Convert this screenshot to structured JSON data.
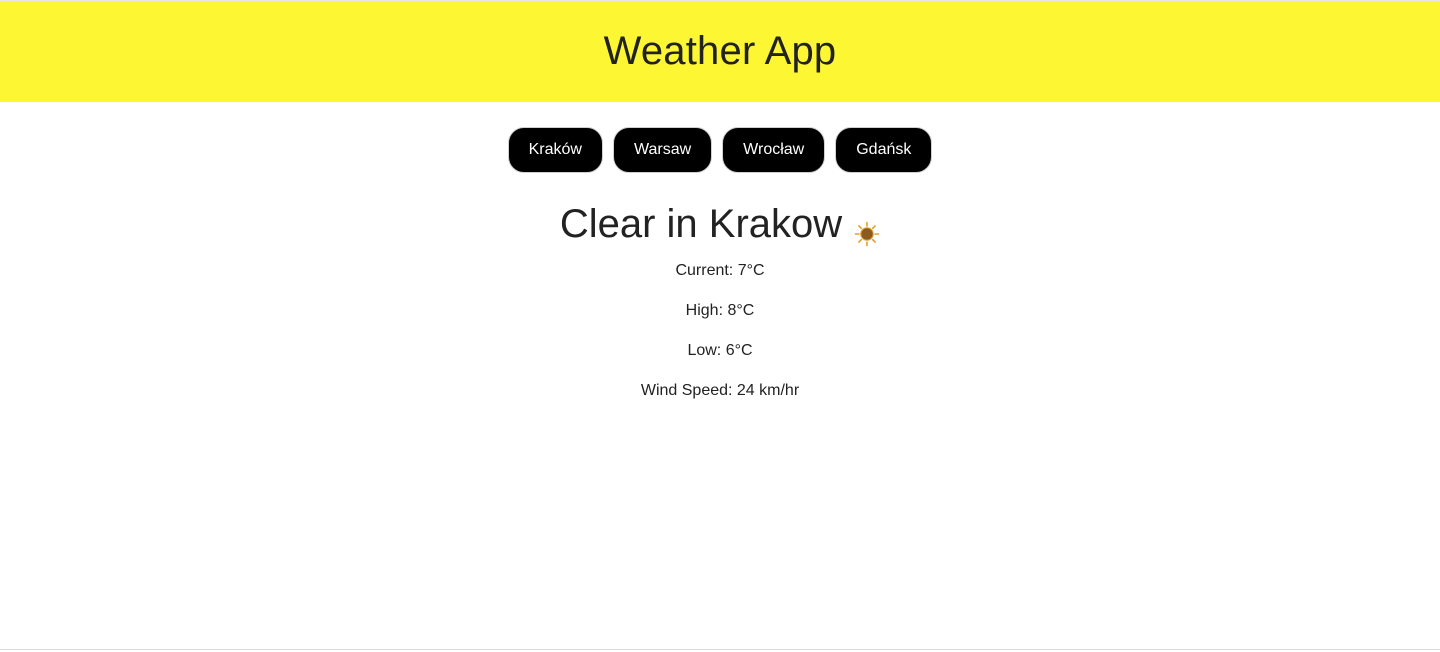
{
  "header": {
    "title": "Weather App",
    "background": "#fdf733"
  },
  "cities": [
    {
      "label": "Kraków"
    },
    {
      "label": "Warsaw"
    },
    {
      "label": "Wrocław"
    },
    {
      "label": "Gdańsk"
    }
  ],
  "weather": {
    "title": "Clear in Krakow",
    "condition_icon": "sun-icon",
    "current": "Current: 7°C",
    "high": "High: 8°C",
    "low": "Low: 6°C",
    "wind": "Wind Speed: 24 km/hr"
  }
}
